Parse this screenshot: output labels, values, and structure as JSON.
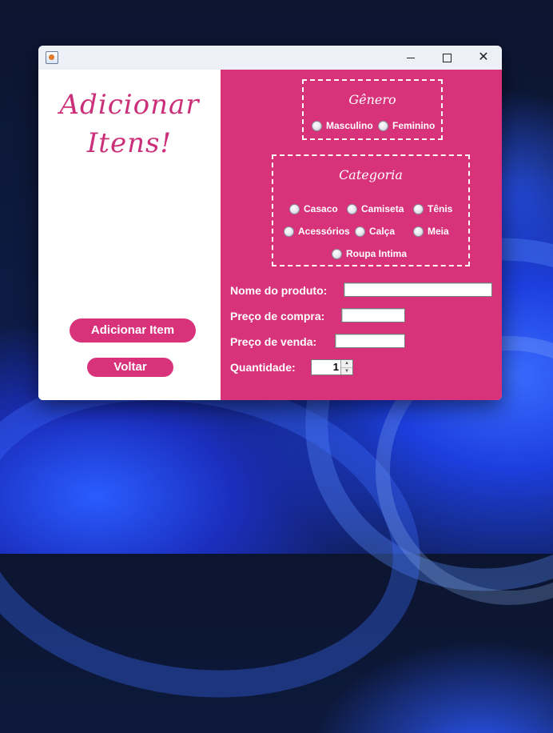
{
  "window": {
    "left_panel": {
      "heading_line1": "Adicionar",
      "heading_line2": "Itens!",
      "add_button": "Adicionar Item",
      "back_button": "Voltar"
    },
    "genero": {
      "title": "Gênero",
      "options": [
        "Masculino",
        "Feminino"
      ]
    },
    "categoria": {
      "title": "Categoria",
      "options": [
        "Casaco",
        "Camiseta",
        "Tênis",
        "Acessórios",
        "Calça",
        "Meia",
        "Roupa Intima"
      ]
    },
    "form": {
      "nome_label": "Nome do produto:",
      "nome_value": "",
      "compra_label": "Preço de compra:",
      "compra_value": "",
      "venda_label": "Preço de venda:",
      "venda_value": "",
      "quantidade_label": "Quantidade:",
      "quantidade_value": "1"
    }
  },
  "colors": {
    "accent": "#d8327b",
    "heading": "#cc2f79"
  },
  "icons": {
    "app": "java-app-icon",
    "minimize": "minimize-icon",
    "maximize": "maximize-icon",
    "close": "close-icon"
  }
}
